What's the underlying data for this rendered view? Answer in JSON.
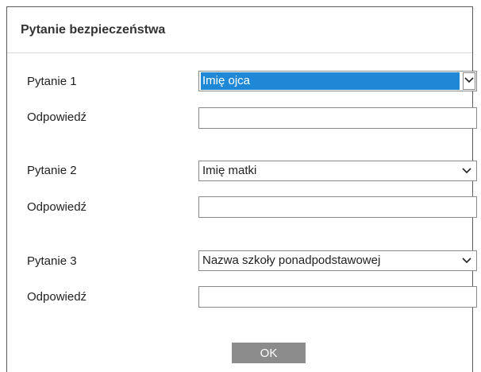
{
  "dialog": {
    "title": "Pytanie bezpieczeństwa",
    "ok_label": "OK"
  },
  "questions": [
    {
      "label": "Pytanie 1",
      "selected": "Imię ojca",
      "answer_label": "Odpowiedź",
      "answer_value": ""
    },
    {
      "label": "Pytanie 2",
      "selected": "Imię matki",
      "answer_label": "Odpowiedź",
      "answer_value": ""
    },
    {
      "label": "Pytanie 3",
      "selected": "Nazwa szkoły ponadpodstawowej",
      "answer_label": "Odpowiedź",
      "answer_value": ""
    }
  ],
  "colors": {
    "selection_highlight": "#1e88d6",
    "ok_button": "#8c8c8c"
  },
  "icons": {
    "dropdown": "chevron-down-icon"
  }
}
